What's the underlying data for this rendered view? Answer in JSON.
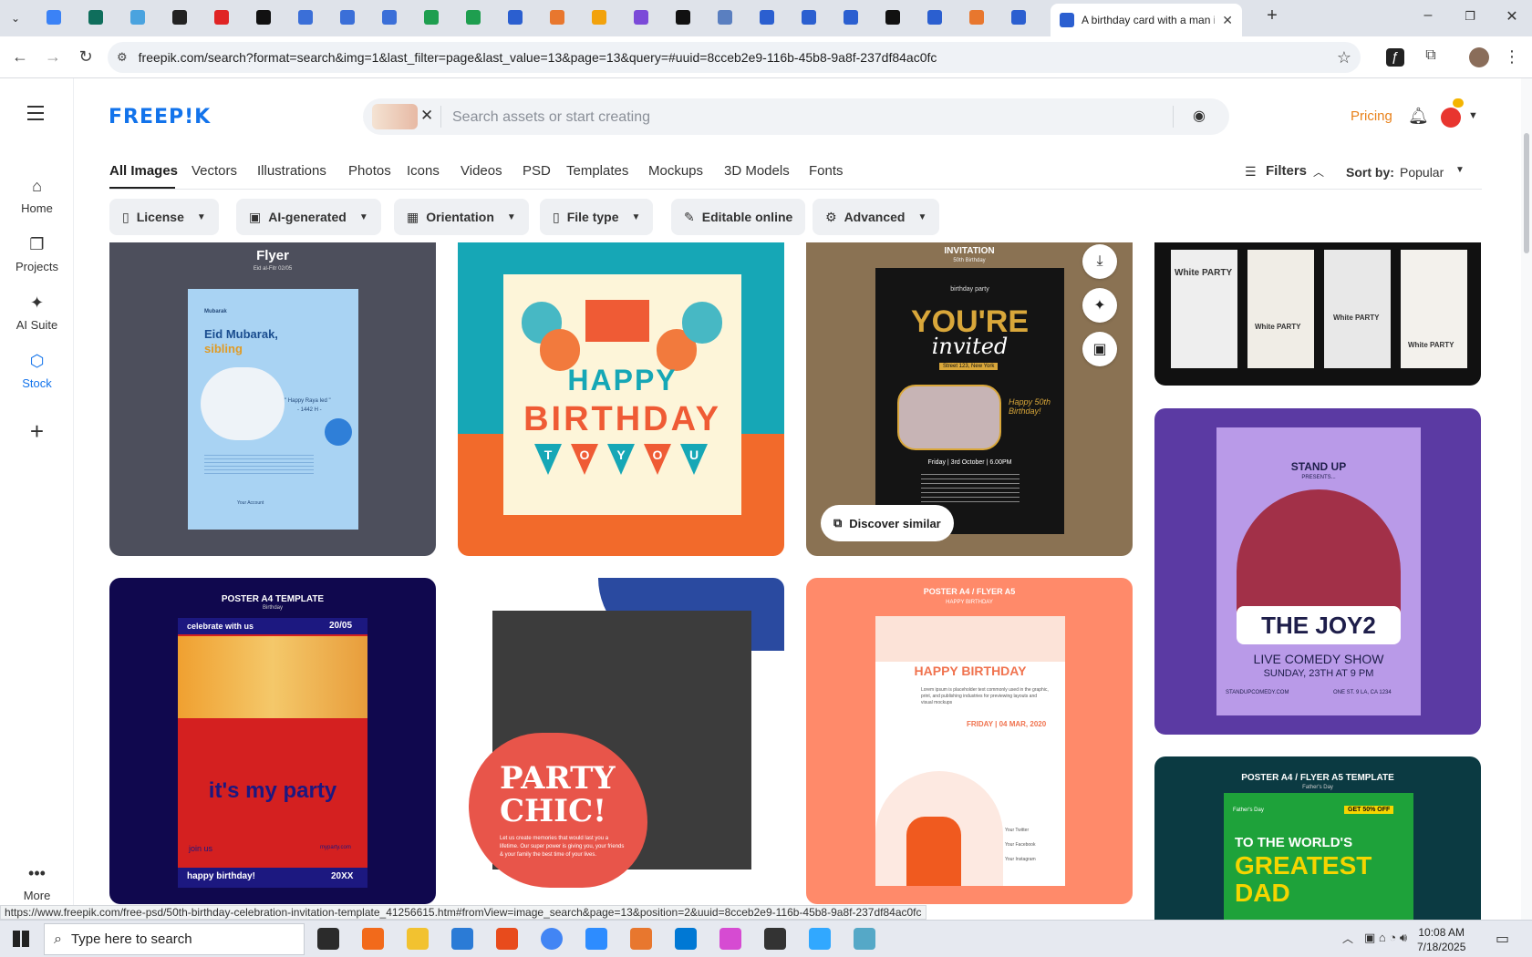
{
  "browser": {
    "active_tab_title": "A birthday card with a man in a",
    "url": "freepik.com/search?format=search&img=1&last_filter=page&last_value=13&page=13&query=#uuid=8cceb2e9-116b-45b8-9a8f-237df84ac0fc",
    "status_url": "https://www.freepik.com/free-psd/50th-birthday-celebration-invitation-template_41256615.htm#fromView=image_search&page=13&position=2&uuid=8cceb2e9-116b-45b8-9a8f-237df84ac0fc",
    "tab_colors": [
      "#3b82f6",
      "#0f6e5c",
      "#4aa3df",
      "#222222",
      "#e02424",
      "#111111",
      "#3b6fd8",
      "#3b6fd8",
      "#3b6fd8",
      "#1e9e4f",
      "#1e9e4f",
      "#2b5fd0",
      "#e8772e",
      "#f2a20c",
      "#7b4ad8",
      "#111111",
      "#5a7fc0",
      "#2b5fd0",
      "#2b5fd0",
      "#2b5fd0",
      "#111111",
      "#2b5fd0",
      "#e8772e",
      "#2b5fd0"
    ]
  },
  "rail": {
    "home": "Home",
    "projects": "Projects",
    "ai_suite": "AI Suite",
    "stock": "Stock",
    "more": "More"
  },
  "header": {
    "logo": "FREEP!K",
    "search_placeholder": "Search assets or start creating",
    "pricing": "Pricing"
  },
  "categories": [
    "All Images",
    "Vectors",
    "Illustrations",
    "Photos",
    "Icons",
    "Videos",
    "PSD",
    "Templates",
    "Mockups",
    "3D Models",
    "Fonts"
  ],
  "toolbar": {
    "filters": "Filters",
    "sort_label": "Sort by:",
    "sort_value": "Popular"
  },
  "chips": [
    "License",
    "AI-generated",
    "Orientation",
    "File type",
    "Editable online",
    "Advanced"
  ],
  "cards": {
    "flyer": {
      "title": "Flyer",
      "sub": "Eid al-Fitr 02/05",
      "brand": "Mubarak",
      "headline": "Eid Mubarak,",
      "headline2": "sibling",
      "quote": "\" Happy Raya Ied \"",
      "quote2": "- 1442 H -",
      "account": "Your Account"
    },
    "birthday": {
      "line1": "HAPPY",
      "line2": "BIRTHDAY",
      "flags": [
        "T",
        "O",
        "Y",
        "O",
        "U"
      ]
    },
    "invitation": {
      "header": "INVITATION",
      "sub": "50th Birthday",
      "brand": "birthday party",
      "line1": "YOU'RE",
      "line2": "invited",
      "address": "Street 123, New York",
      "date": "Friday | 3rd October | 6.00PM",
      "side": "Happy 50th Birthday!",
      "discover": "Discover similar"
    },
    "white_party": {
      "w1": "White PARTY",
      "w2": "White PARTY",
      "w3": "White PARTY",
      "w4": "White PARTY"
    },
    "standup": {
      "title": "STAND UP",
      "presents": "PRESENTS...",
      "name": "THE JOY2",
      "show": "LIVE COMEDY SHOW",
      "when": "SUNDAY, 23TH AT 9 PM",
      "site": "STANDUPCOMEDY.COM",
      "addr": "ONE ST. 9 LA, CA 1234"
    },
    "my_party": {
      "header": "POSTER A4 TEMPLATE",
      "sub": "Birthday",
      "tag": "celebrate with us",
      "date": "20/05",
      "headline": "it's my party",
      "join": "join us",
      "site": "myparty.com",
      "foot": "happy birthday!",
      "year": "20XX"
    },
    "party_chic": {
      "line1": "PARTY",
      "line2": "CHIC!",
      "body": "Let us create memories that would last you a lifetime. Our super power is giving you, your friends & your family the best time of your lives."
    },
    "kid": {
      "header": "POSTER A4 / FLYER A5",
      "sub": "HAPPY BIRTHDAY",
      "title": "HAPPY BIRTHDAY",
      "body": "Lorem ipsum is placeholder text commonly used in the graphic, print, and publishing industries for previewing layouts and visual mockups",
      "date": "FRIDAY | 04 MAR, 2020",
      "s1": "Your Twitter",
      "s2": "Your Facebook",
      "s3": "Your Instagram"
    },
    "dad": {
      "header": "POSTER A4 / FLYER A5 TEMPLATE",
      "sub": "Father's Day",
      "tag": "Father's Day",
      "offer": "GET 50% OFF",
      "line1": "TO THE WORLD'S",
      "line2": "GREATEST",
      "line3": "DAD"
    }
  },
  "taskbar": {
    "search": "Type here to search",
    "time": "10:08 AM",
    "date": "7/18/2025"
  }
}
